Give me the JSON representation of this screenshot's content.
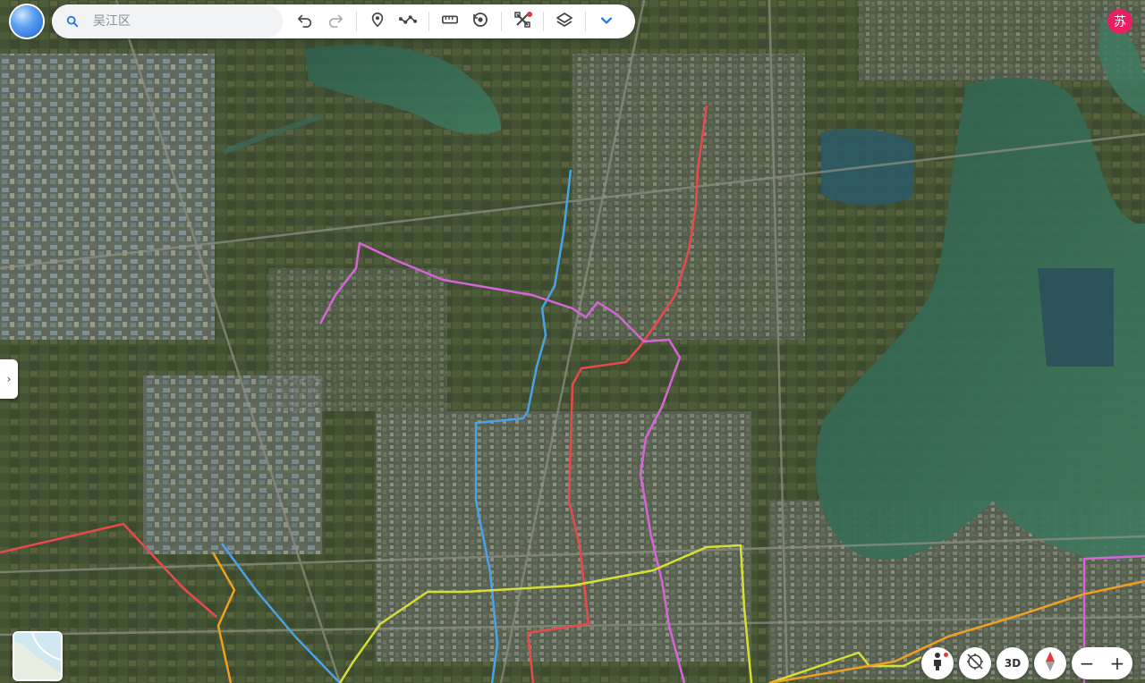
{
  "search": {
    "placeholder": "吴江区"
  },
  "user": {
    "avatar_text": "苏"
  },
  "controls": {
    "view3d_label": "3D",
    "zoom_out_label": "−",
    "zoom_in_label": "+"
  },
  "toolbar_icons": [
    "search-icon",
    "undo-icon",
    "redo-icon",
    "marker-icon",
    "path-icon",
    "ruler-icon",
    "history-icon",
    "satellite-tools-icon",
    "layers-icon",
    "chevron-down-icon"
  ],
  "colors": {
    "red_route": "#e84a4a",
    "blue_route": "#4aa3e8",
    "magenta_route": "#d765d8",
    "yellow_route": "#d6e034",
    "orange_route": "#f0a020",
    "accent": "#1a73e8"
  }
}
